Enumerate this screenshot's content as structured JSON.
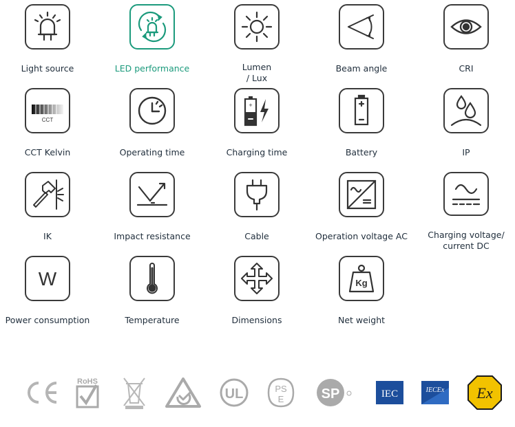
{
  "icons": [
    {
      "label": "Light source",
      "icon": "led-bulb-icon",
      "active": false
    },
    {
      "label": "LED performance",
      "icon": "led-performance-icon",
      "active": true
    },
    {
      "label": "Lumen\n/ Lux",
      "icon": "sun-icon",
      "active": false
    },
    {
      "label": "Beam angle",
      "icon": "beam-angle-icon",
      "active": false
    },
    {
      "label": "CRI",
      "icon": "eye-icon",
      "active": false
    },
    {
      "label": "CCT Kelvin",
      "icon": "cct-gradient-icon",
      "icon_text": "CCT",
      "active": false
    },
    {
      "label": "Operating time",
      "icon": "clock-icon",
      "active": false
    },
    {
      "label": "Charging time",
      "icon": "battery-charging-icon",
      "active": false
    },
    {
      "label": "Battery",
      "icon": "battery-icon",
      "active": false
    },
    {
      "label": "IP",
      "icon": "water-drops-icon",
      "active": false
    },
    {
      "label": "IK",
      "icon": "hammer-impact-icon",
      "active": false
    },
    {
      "label": "Impact resistance",
      "icon": "impact-arrow-icon",
      "active": false
    },
    {
      "label": "Cable",
      "icon": "plug-icon",
      "active": false
    },
    {
      "label": "Operation voltage AC",
      "icon": "ac-converter-icon",
      "active": false
    },
    {
      "label": "Charging  voltage/\ncurrent DC",
      "icon": "ac-dc-icon",
      "active": false
    },
    {
      "label": "Power consumption",
      "icon": "watt-icon",
      "icon_text": "W",
      "active": false
    },
    {
      "label": "Temperature",
      "icon": "thermometer-icon",
      "active": false
    },
    {
      "label": "Dimensions",
      "icon": "move-arrows-icon",
      "active": false
    },
    {
      "label": "Net weight",
      "icon": "weight-icon",
      "icon_text": "Kg",
      "active": false
    }
  ],
  "certifications": [
    {
      "name": "ce-mark",
      "text": "CE"
    },
    {
      "name": "rohs-mark",
      "text": "RoHS"
    },
    {
      "name": "weee-bin-mark",
      "text": ""
    },
    {
      "name": "rcm-mark",
      "text": ""
    },
    {
      "name": "ul-mark",
      "text": "UL"
    },
    {
      "name": "pse-mark",
      "text": "PS E"
    },
    {
      "name": "csa-mark",
      "text": "SP"
    },
    {
      "name": "iec-mark",
      "text": "IEC"
    },
    {
      "name": "iecex-mark",
      "text": "IECEx"
    },
    {
      "name": "atex-ex-mark",
      "text": "Ex"
    }
  ],
  "colors": {
    "accent": "#1b9a7c",
    "stroke": "#3a3a3a",
    "iec_blue": "#1c4e9c"
  }
}
